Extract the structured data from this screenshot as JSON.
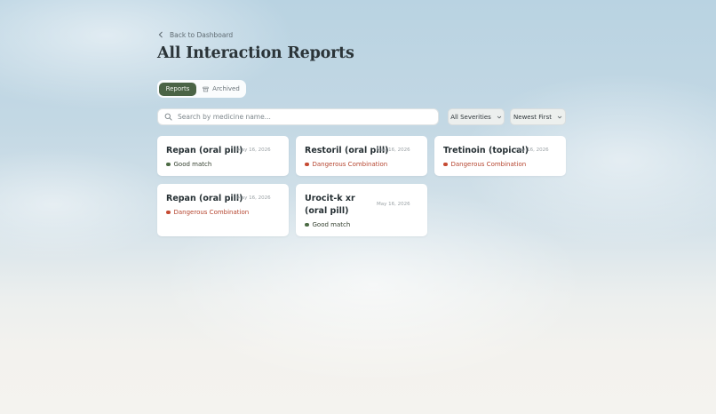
{
  "nav": {
    "back_label": "Back to Dashboard"
  },
  "page": {
    "title": "All Interaction Reports"
  },
  "tabs": [
    {
      "label": "Reports",
      "active": true
    },
    {
      "label": "Archived",
      "active": false,
      "icon": "archive-icon"
    }
  ],
  "search": {
    "placeholder": "Search by medicine name...",
    "value": "",
    "icon": "search-icon"
  },
  "filters": {
    "severity": "All Severities",
    "sort": "Newest First"
  },
  "reports": [
    {
      "name": "Repan (oral pill)",
      "date": "May 16, 2026",
      "status": "Good match",
      "severity": "good"
    },
    {
      "name": "Restoril (oral pill)",
      "date": "May 16, 2026",
      "status": "Dangerous Combination",
      "severity": "dangerous"
    },
    {
      "name": "Tretinoin (topical)",
      "date": "May 16, 2026",
      "status": "Dangerous Combination",
      "severity": "dangerous"
    },
    {
      "name": "Repan (oral pill)",
      "date": "May 16, 2026",
      "status": "Dangerous Combination",
      "severity": "dangerous"
    },
    {
      "name": "Urocit-k xr (oral pill)",
      "date": "May 16, 2026",
      "status": "Good match",
      "severity": "good"
    }
  ],
  "colors": {
    "accent": "#4b6446",
    "good": "#4c6b45",
    "dangerous": "#c64b33"
  }
}
